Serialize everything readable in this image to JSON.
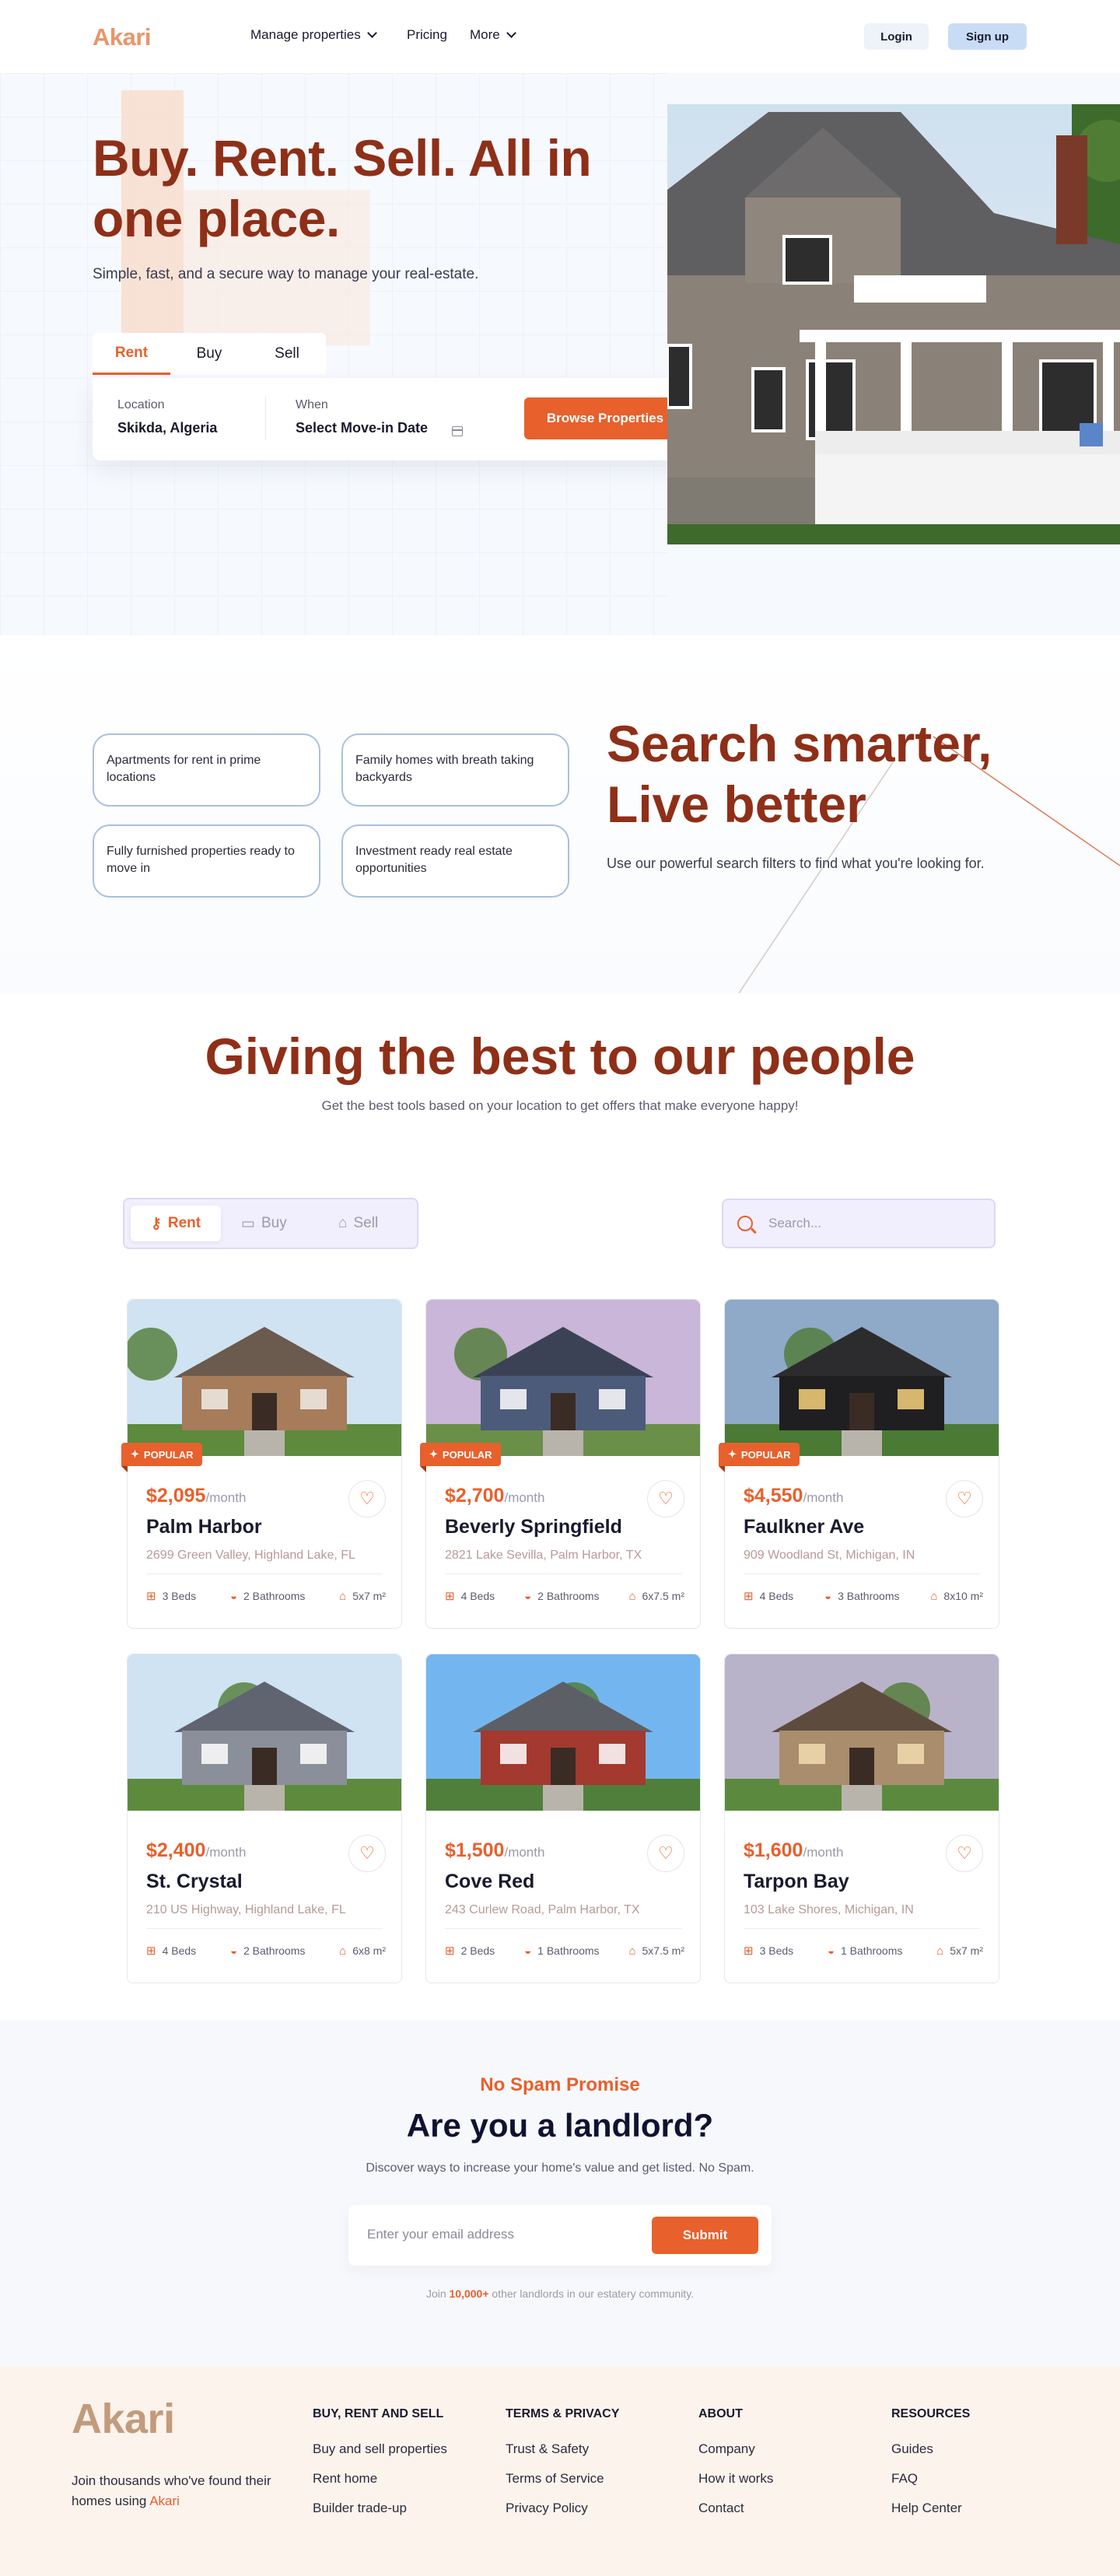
{
  "nav": {
    "logo": "Akari",
    "links": [
      {
        "label": "Manage properties",
        "dropdown": true
      },
      {
        "label": "Pricing",
        "dropdown": false
      },
      {
        "label": "More",
        "dropdown": true
      }
    ],
    "login": "Login",
    "signup": "Sign up"
  },
  "hero": {
    "title": "Buy. Rent. Sell. All in one place.",
    "subtitle": "Simple, fast, and a secure way to manage your real-estate.",
    "tabs": [
      "Rent",
      "Buy",
      "Sell"
    ],
    "active_tab": "Rent",
    "location_label": "Location",
    "location_value": "Skikda, Algeria",
    "when_label": "When",
    "when_value": "Select Move-in Date",
    "browse_button": "Browse Properties"
  },
  "smart": {
    "pills": [
      "Apartments for rent in prime locations",
      "Family homes with breath taking backyards",
      "Fully furnished properties ready to move in",
      "Investment ready real estate opportunities"
    ],
    "title_line1": "Search smarter,",
    "title_line2": "Live better",
    "subtitle": "Use our powerful search filters to find what you're looking for."
  },
  "properties": {
    "title": "Giving the best to our people",
    "subtitle": "Get the best tools based on your location to get offers that make everyone happy!",
    "filter_tabs": [
      "Rent",
      "Buy",
      "Sell"
    ],
    "active_filter": "Rent",
    "search_placeholder": "Search...",
    "badge": "POPULAR",
    "per_month": "/month",
    "listings": [
      {
        "price": "$2,095",
        "name": "Palm Harbor",
        "address": "2699 Green Valley, Highland Lake, FL",
        "beds": "3 Beds",
        "baths": "2 Bathrooms",
        "area": "5x7 m²",
        "popular": true
      },
      {
        "price": "$2,700",
        "name": "Beverly Springfield",
        "address": "2821 Lake Sevilla, Palm Harbor, TX",
        "beds": "4 Beds",
        "baths": "2 Bathrooms",
        "area": "6x7.5 m²",
        "popular": true
      },
      {
        "price": "$4,550",
        "name": "Faulkner Ave",
        "address": "909 Woodland St, Michigan, IN",
        "beds": "4 Beds",
        "baths": "3 Bathrooms",
        "area": "8x10 m²",
        "popular": true
      },
      {
        "price": "$2,400",
        "name": "St. Crystal",
        "address": "210 US Highway, Highland Lake, FL",
        "beds": "4 Beds",
        "baths": "2 Bathrooms",
        "area": "6x8 m²",
        "popular": false
      },
      {
        "price": "$1,500",
        "name": "Cove Red",
        "address": "243 Curlew Road, Palm Harbor, TX",
        "beds": "2 Beds",
        "baths": "1 Bathrooms",
        "area": "5x7.5 m²",
        "popular": false
      },
      {
        "price": "$1,600",
        "name": "Tarpon Bay",
        "address": "103 Lake Shores, Michigan, IN",
        "beds": "3 Beds",
        "baths": "1 Bathrooms",
        "area": "5x7 m²",
        "popular": false
      }
    ]
  },
  "landlord": {
    "eyebrow": "No Spam Promise",
    "title": "Are you a landlord?",
    "subtitle": "Discover ways to increase your home's value and  get listed. No Spam.",
    "email_placeholder": "Enter your email address",
    "submit": "Submit",
    "join_prefix": "Join ",
    "join_count": "10,000+",
    "join_suffix": " other landlords in our estatery community."
  },
  "footer": {
    "logo": "Akari",
    "tagline_prefix": "Join thousands who've found their homes using ",
    "tagline_brand": "Akari",
    "columns": [
      {
        "title": "BUY, RENT AND SELL",
        "links": [
          "Buy and sell properties",
          "Rent home",
          "Builder trade-up"
        ]
      },
      {
        "title": "TERMS & PRIVACY",
        "links": [
          "Trust & Safety",
          "Terms of Service",
          "Privacy Policy"
        ]
      },
      {
        "title": "ABOUT",
        "links": [
          "Company",
          "How it works",
          "Contact"
        ]
      },
      {
        "title": "RESOURCES",
        "links": [
          "Guides",
          "FAQ",
          "Help Center"
        ]
      }
    ]
  },
  "colors": {
    "accent": "#e8602c",
    "heading": "#8f2f18",
    "logo": "#e8956a"
  }
}
